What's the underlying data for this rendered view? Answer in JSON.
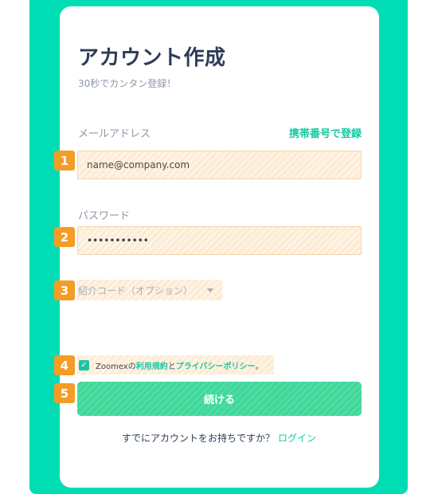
{
  "form": {
    "title": "アカウント作成",
    "subtitle": "30秒でカンタン登録！",
    "email": {
      "label": "メールアドレス",
      "switch_link": "携帯番号で登録",
      "placeholder": "name@company.com",
      "badge": "1"
    },
    "password": {
      "label": "パスワード",
      "value": "•••••••••••",
      "badge": "2"
    },
    "referral": {
      "selected": "紹介コード（オプション）",
      "badge": "3"
    },
    "terms": {
      "checked": true,
      "check_glyph": "✓",
      "prefix": "Zoomexの",
      "terms_link": "利用規約",
      "middle": "と",
      "privacy_link": "プライバシーポリシー",
      "suffix": "。",
      "badge": "4"
    },
    "continue": {
      "label": "続ける",
      "badge": "5"
    },
    "login": {
      "prompt": "すでにアカウントをお持ちですか？",
      "link": "ログイン"
    }
  },
  "colors": {
    "frame": "#00dcb4",
    "accent": "#16c9a4",
    "badge": "#f39c26",
    "button": "#3fd89a",
    "title": "#2e3d56"
  },
  "icons": {
    "checkbox": "check-icon",
    "dropdown": "chevron-down-icon"
  }
}
